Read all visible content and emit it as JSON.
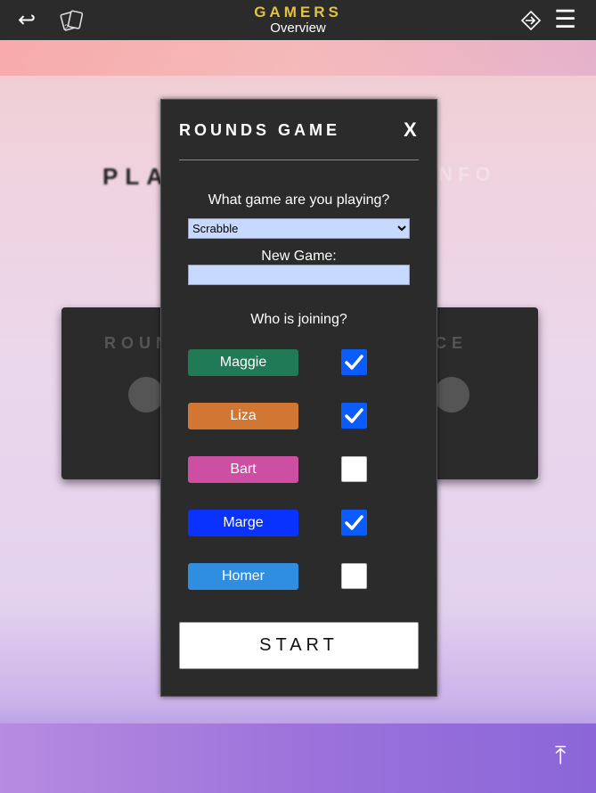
{
  "topbar": {
    "brand": "GAMERS",
    "subtitle": "Overview",
    "back_icon": "↩",
    "menu_icon": "☰"
  },
  "background": {
    "title_left": "PLA",
    "title_right": "INFO",
    "card_label_left": "ROUN",
    "card_label_right": "NCE"
  },
  "modal": {
    "title": "ROUNDS GAME",
    "close_label": "X",
    "question_game": "What game are you playing?",
    "game_select": {
      "selected": "Scrabble"
    },
    "new_game_label": "New Game:",
    "new_game_value": "",
    "question_join": "Who is joining?",
    "players": [
      {
        "name": "Maggie",
        "color": "#1f7a55",
        "checked": true
      },
      {
        "name": "Liza",
        "color": "#d27733",
        "checked": true
      },
      {
        "name": "Bart",
        "color": "#cc4fa3",
        "checked": false
      },
      {
        "name": "Marge",
        "color": "#0a32ff",
        "checked": true
      },
      {
        "name": "Homer",
        "color": "#2f8ee0",
        "checked": false
      }
    ],
    "start_label": "START"
  },
  "scroll_top_icon": "⤒"
}
